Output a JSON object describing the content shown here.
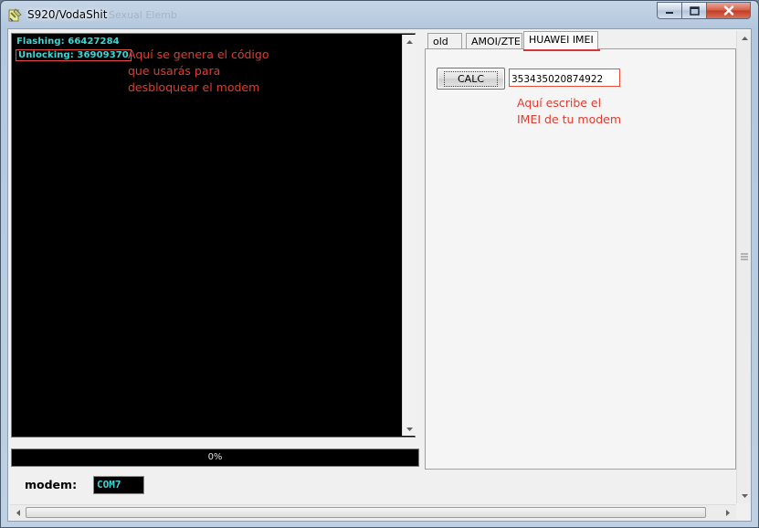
{
  "window": {
    "title": "S920/VodaShit",
    "ghost_title": "Sexual Elemb"
  },
  "console": {
    "lines": [
      "Flashing: 66427284",
      "Unlocking: 36909370"
    ],
    "annotation": "Aquí se genera el código\nque usarás para\ndesbloquear el modem"
  },
  "progress": {
    "label": "0%",
    "value": 0
  },
  "modem": {
    "label": "modem:",
    "port": "COM7"
  },
  "tabs": {
    "items": [
      "old",
      "AMOI/ZTE",
      "HUAWEI IMEI"
    ],
    "active": "HUAWEI IMEI"
  },
  "huawei": {
    "calc_label": "CALC",
    "imei_value": "353435020874922",
    "annotation": "Aquí escribe el\nIMEI de tu modem"
  },
  "icons": {
    "app": "tool-icon",
    "minimize": "minimize-icon",
    "maximize": "maximize-icon",
    "close": "close-icon"
  },
  "colors": {
    "console_bg": "#000000",
    "console_text": "#38d8d8",
    "annotation": "#e33b2e",
    "highlight": "#e74c3c"
  }
}
